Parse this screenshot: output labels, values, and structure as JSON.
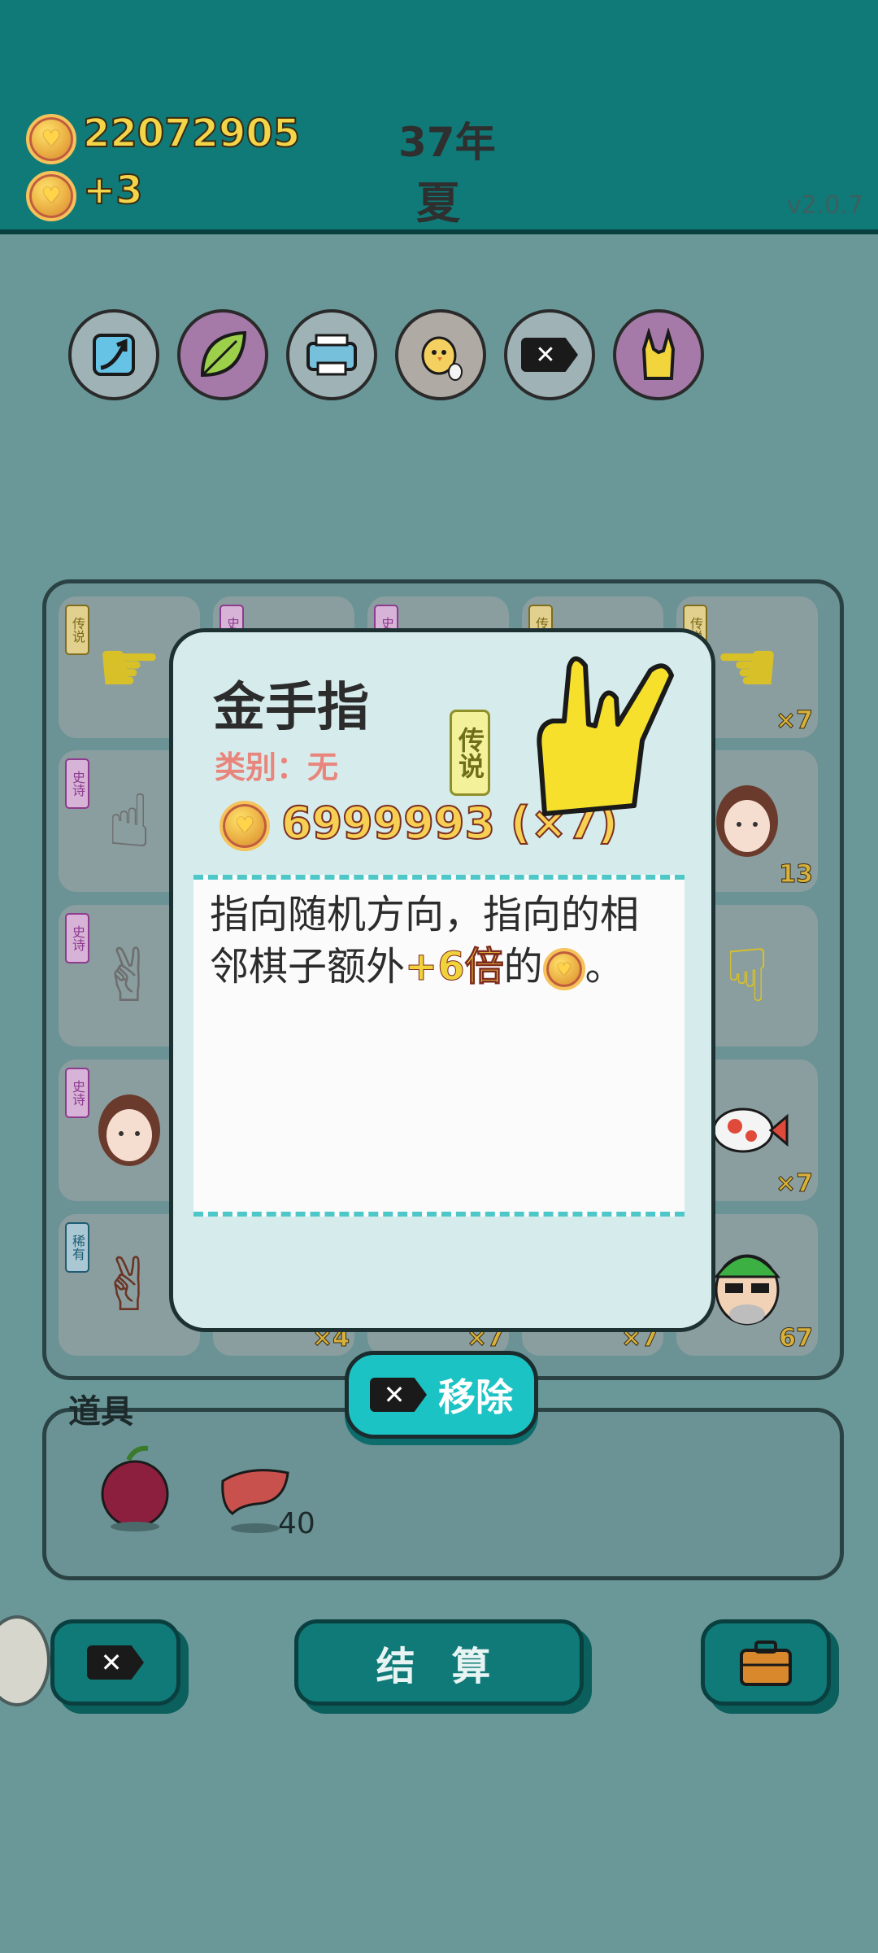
{
  "header": {
    "money": "22072905",
    "income": "+3",
    "year": "37年",
    "season": "夏",
    "version": "v2.0.7"
  },
  "relics": [
    {
      "icon": "arrow-icon"
    },
    {
      "icon": "leaf-icon"
    },
    {
      "icon": "printer-icon"
    },
    {
      "icon": "chick-icon"
    },
    {
      "icon": "remove-tag-icon"
    },
    {
      "icon": "rock-hand-icon"
    }
  ],
  "board": {
    "cells": [
      {
        "tag": "传说",
        "count": ""
      },
      {
        "tag": "史诗",
        "count": ""
      },
      {
        "tag": "史诗",
        "count": ""
      },
      {
        "tag": "传说",
        "count": ""
      },
      {
        "tag": "传说",
        "count": "×7"
      },
      {
        "tag": "史诗",
        "count": ""
      },
      {
        "tag": "",
        "count": "13"
      },
      {
        "tag": "史诗",
        "count": ""
      },
      {
        "tag": "",
        "count": ""
      },
      {
        "tag": "史诗",
        "count": "×"
      },
      {
        "tag": "",
        "count": "×7"
      },
      {
        "tag": "稀有",
        "count": ""
      },
      {
        "tag": "",
        "count": "×4"
      },
      {
        "tag": "",
        "count": "×7"
      },
      {
        "tag": "",
        "count": "×7"
      },
      {
        "tag": "",
        "count": "67"
      }
    ]
  },
  "items": {
    "label": "道具",
    "list": [
      {
        "icon": "bayberry-icon",
        "count": ""
      },
      {
        "icon": "liver-icon",
        "count": "40"
      }
    ]
  },
  "buttons": {
    "settle": "结 算"
  },
  "modal": {
    "title": "金手指",
    "category": "类别：无",
    "rarity": "传说",
    "value": "6999993 (×7)",
    "desc_pre": "指向随机方向，指向的相邻棋子额外",
    "desc_hl": "+6倍",
    "desc_mid": "的",
    "desc_post": "。",
    "remove": "移除"
  },
  "colors": {
    "header_bg": "#0f7a77",
    "modal_bg": "#d6ecec",
    "accent_cyan": "#1cc3c4",
    "gold": "#f3d54a"
  }
}
